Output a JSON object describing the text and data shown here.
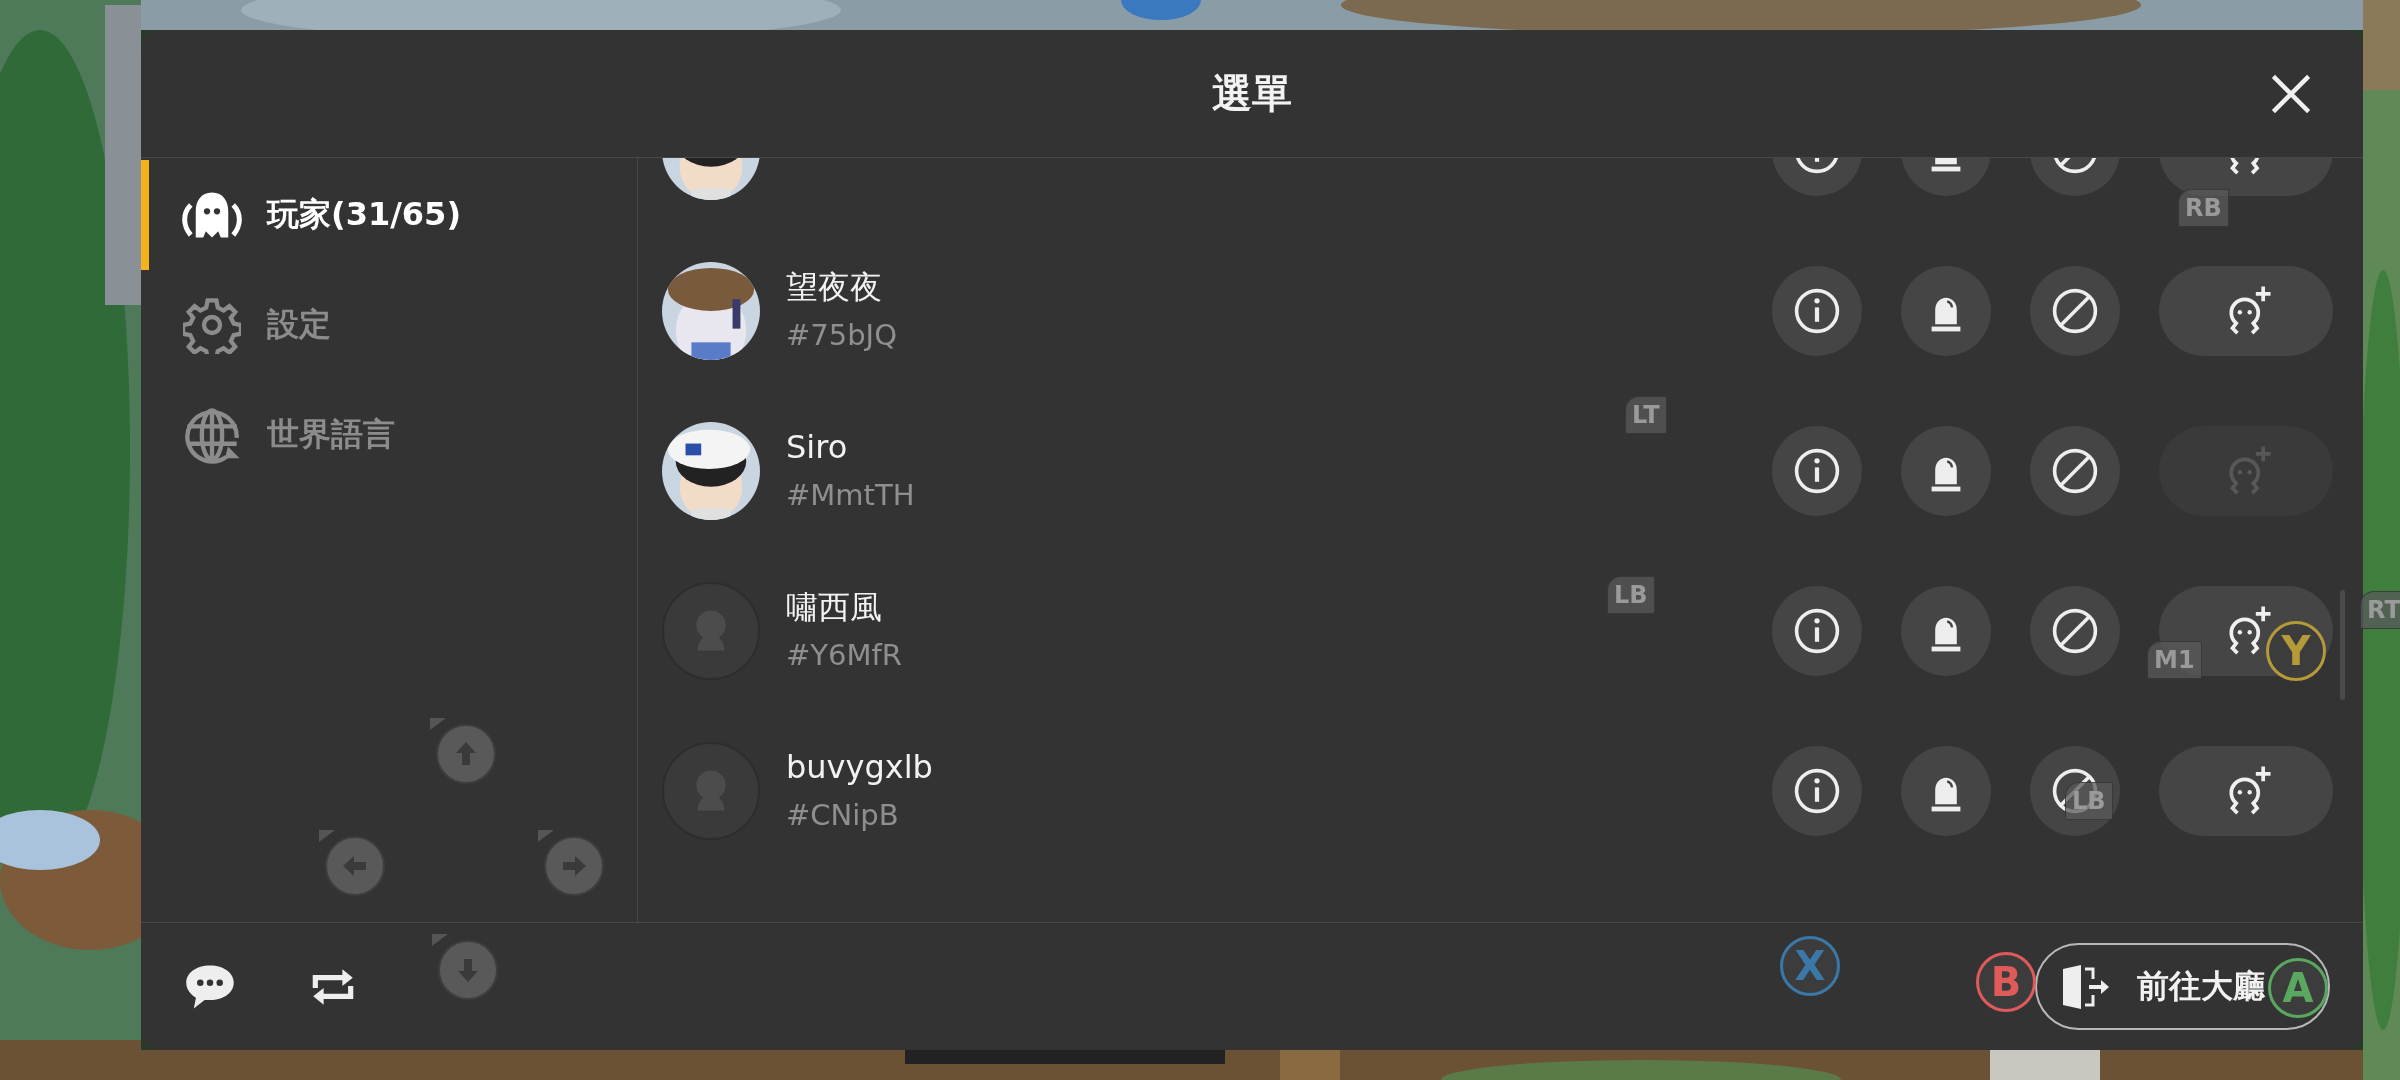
{
  "header": {
    "title": "選單"
  },
  "sidebar": {
    "items": [
      {
        "kind": "players",
        "label": "玩家(31/65)",
        "selected": true
      },
      {
        "kind": "settings",
        "label": "設定",
        "selected": false
      },
      {
        "kind": "language",
        "label": "世界語言",
        "selected": false
      }
    ]
  },
  "players": [
    {
      "kind": "cut",
      "has_avatar": true,
      "friend_request_disabled": false
    },
    {
      "kind": "full",
      "name": "望夜夜",
      "tag": "#75bJQ",
      "has_avatar": true,
      "friend_request_disabled": false
    },
    {
      "kind": "full",
      "name": "Siro",
      "tag": "#MmtTH",
      "has_avatar": true,
      "friend_request_disabled": true
    },
    {
      "kind": "full",
      "name": "嘯西風",
      "tag": "#Y6MfR",
      "has_avatar": false,
      "friend_request_disabled": false
    },
    {
      "kind": "full",
      "name": "buvygxlb",
      "tag": "#CNipB",
      "has_avatar": false,
      "friend_request_disabled": false
    }
  ],
  "footer": {
    "lobby_button": "前往大廳"
  },
  "gamepad_hints": [
    {
      "kind": "up"
    },
    {
      "kind": "left"
    },
    {
      "kind": "right"
    },
    {
      "kind": "down"
    },
    {
      "kind": "tag",
      "label": "LT"
    },
    {
      "kind": "tag",
      "label": "LB"
    },
    {
      "kind": "tag",
      "label": "RB"
    },
    {
      "kind": "tag",
      "label": "RT"
    },
    {
      "kind": "tag",
      "label": "M1"
    },
    {
      "kind": "round",
      "label": "Y",
      "color": "#b59a3a"
    },
    {
      "kind": "tag",
      "label": "LB"
    },
    {
      "kind": "round",
      "label": "X",
      "color": "#3a78a8"
    },
    {
      "kind": "round",
      "label": "B",
      "color": "#e05a5a"
    },
    {
      "kind": "round",
      "label": "A",
      "color": "#5aa860"
    }
  ]
}
